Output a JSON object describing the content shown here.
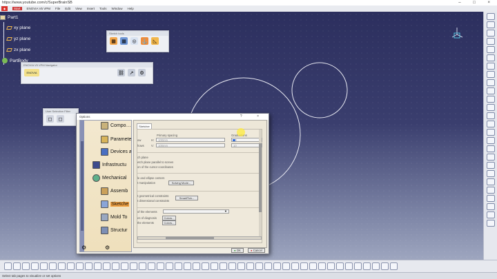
{
  "window": {
    "title": "https://www.youtube.com/c/SuperBrainSB",
    "controls": "–  □  ×"
  },
  "menubar": {
    "items": [
      "Start",
      "ENOVIA V5 VPM",
      "File",
      "Edit",
      "View",
      "Insert",
      "Tools",
      "Window",
      "Help"
    ]
  },
  "tree": {
    "part": "Part1",
    "planes": [
      "xy plane",
      "yz plane",
      "zx plane"
    ],
    "body": "PartBody"
  },
  "floating": {
    "sketch_tools": "Sketch tools",
    "enovia_nav": "ENOVIA V5 VPM Navigator",
    "enovia_logo": "ENOVIA",
    "user_selection": "User Selection Filter"
  },
  "dialog": {
    "title": "Options",
    "title_buttons": "?  ×",
    "categories": [
      "Compo…",
      "Paramete",
      "Devices a",
      "Infrastructu",
      "Mechanical",
      "Assemb",
      "Sketche",
      "Mold To",
      "Structur"
    ],
    "tab": "Sketcher",
    "grid": {
      "primary_spacing": "Primary spacing",
      "graduations": "Graduations",
      "h_prefix": "ow",
      "v_prefix": "hows",
      "h_axis": "H:",
      "v_axis": "V:",
      "h_value": "100mm",
      "v_value": "100mm",
      "grad_h": "10",
      "grad_v": "10"
    },
    "sketch_plane": {
      "line1": "ch plane",
      "line2": "etch plane parallel to screen",
      "line3": "on of the cursor coordinates"
    },
    "geometry": {
      "line1": "le and ellipse centers",
      "line2": "t manipulation",
      "button": "Solving Mode..."
    },
    "constraint": {
      "line1": "t geometrical constraints",
      "line2": "t dimensional constraints",
      "button": "SmartPick..."
    },
    "colors": {
      "line1": "of the elements",
      "line2": "es of diagnosis",
      "line3": "the elements",
      "btn1": "Colors...",
      "btn2": "Colors..."
    },
    "ok": "OK",
    "cancel": "Cancel"
  },
  "statusbar": {
    "text": "Select tab pages to visualize or set options"
  },
  "colors": {
    "accent": "#d9312b",
    "canvas_top": "#2c2f5e",
    "dialog_tree": "#f3e8cf",
    "selected_category": "#f0a040"
  }
}
